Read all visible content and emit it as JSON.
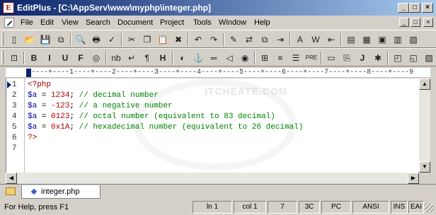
{
  "title": "EditPlus - [C:\\AppServ\\www\\myphp\\integer.php]",
  "window_buttons": {
    "minimize": "_",
    "restore": "□",
    "close": "×"
  },
  "menu": [
    "File",
    "Edit",
    "View",
    "Search",
    "Document",
    "Project",
    "Tools",
    "Window",
    "Help"
  ],
  "toolbar1": [
    {
      "name": "new-file-icon",
      "glyph": "▯"
    },
    {
      "name": "open-icon",
      "glyph": "📂"
    },
    {
      "name": "save-icon",
      "glyph": "💾"
    },
    {
      "name": "save-all-icon",
      "glyph": "⧉"
    },
    {
      "name": "find-icon",
      "glyph": "🔍"
    },
    {
      "name": "print-icon",
      "glyph": "🖶"
    },
    {
      "name": "spell-check-icon",
      "glyph": "✓"
    },
    {
      "name": "cut-icon",
      "glyph": "✂"
    },
    {
      "name": "copy-icon",
      "glyph": "❐"
    },
    {
      "name": "paste-icon",
      "glyph": "📋"
    },
    {
      "name": "delete-icon",
      "glyph": "✖"
    },
    {
      "name": "undo-icon",
      "glyph": "↶"
    },
    {
      "name": "redo-icon",
      "glyph": "↷"
    },
    {
      "name": "highlight-icon",
      "glyph": "✎"
    },
    {
      "name": "replace-icon",
      "glyph": "⇄"
    },
    {
      "name": "copy-format-icon",
      "glyph": "⧉"
    },
    {
      "name": "goto-icon",
      "glyph": "⇥"
    },
    {
      "name": "font-icon",
      "glyph": "A"
    },
    {
      "name": "word-wrap-icon",
      "glyph": "W"
    },
    {
      "name": "insert-char-icon",
      "glyph": "⇤"
    },
    {
      "name": "ruler-toggle-icon",
      "glyph": "▤"
    },
    {
      "name": "line-number-icon",
      "glyph": "▦"
    },
    {
      "name": "output-window-icon",
      "glyph": "▣"
    },
    {
      "name": "cliptext-icon",
      "glyph": "▥"
    },
    {
      "name": "directory-icon",
      "glyph": "▧"
    }
  ],
  "toolbar2": [
    {
      "name": "html-toolbar-icon",
      "glyph": "⊡"
    },
    {
      "name": "bold-button",
      "glyph": "B",
      "bold": true
    },
    {
      "name": "italic-button",
      "glyph": "I",
      "bold": true
    },
    {
      "name": "underline-button",
      "glyph": "U",
      "bold": true
    },
    {
      "name": "font-tag-button",
      "glyph": "F",
      "bold": true
    },
    {
      "name": "color-icon",
      "glyph": "◎"
    },
    {
      "name": "nbsp-button",
      "glyph": "nb"
    },
    {
      "name": "line-break-button",
      "glyph": "↵"
    },
    {
      "name": "paragraph-button",
      "glyph": "¶"
    },
    {
      "name": "heading-button",
      "glyph": "H",
      "bold": true
    },
    {
      "name": "image-icon",
      "glyph": "◐"
    },
    {
      "name": "anchor-icon",
      "glyph": "⚓"
    },
    {
      "name": "horizontal-rule-icon",
      "glyph": "═"
    },
    {
      "name": "comment-icon",
      "glyph": "◁"
    },
    {
      "name": "target-icon",
      "glyph": "◉"
    },
    {
      "name": "table-icon",
      "glyph": "⊞"
    },
    {
      "name": "center-icon",
      "glyph": "≡"
    },
    {
      "name": "align-icon",
      "glyph": "☰"
    },
    {
      "name": "pre-button",
      "glyph": "PRE"
    },
    {
      "name": "form-icon",
      "glyph": "▭"
    },
    {
      "name": "html-template-icon",
      "glyph": "⎘"
    },
    {
      "name": "javascript-button",
      "glyph": "J",
      "bold": true
    },
    {
      "name": "style-icon",
      "glyph": "✱"
    },
    {
      "name": "preview-icon",
      "glyph": "◰"
    },
    {
      "name": "browser-icon",
      "glyph": "◱"
    },
    {
      "name": "toolbar-extra-icon",
      "glyph": "▨"
    }
  ],
  "ruler": "----+----1----+----2----+----3----+----4----+----5----+----6----+----7----+----8----+----9",
  "code_lines": [
    {
      "num": "1",
      "parts": [
        {
          "t": "<?php",
          "c": "c-php"
        }
      ]
    },
    {
      "num": "2",
      "parts": [
        {
          "t": "$a",
          "c": "c-var"
        },
        {
          "t": " = ",
          "c": "c-op"
        },
        {
          "t": "1234",
          "c": "c-num"
        },
        {
          "t": "; ",
          "c": "c-op"
        },
        {
          "t": "// decimal number",
          "c": "c-cm"
        }
      ]
    },
    {
      "num": "3",
      "parts": [
        {
          "t": "$a",
          "c": "c-var"
        },
        {
          "t": " = ",
          "c": "c-op"
        },
        {
          "t": "-123",
          "c": "c-num"
        },
        {
          "t": "; ",
          "c": "c-op"
        },
        {
          "t": "// a negative number",
          "c": "c-cm"
        }
      ]
    },
    {
      "num": "4",
      "parts": [
        {
          "t": "$a",
          "c": "c-var"
        },
        {
          "t": " = ",
          "c": "c-op"
        },
        {
          "t": "0123",
          "c": "c-num"
        },
        {
          "t": "; ",
          "c": "c-op"
        },
        {
          "t": "// octal number (equivalent to 83 decimal)",
          "c": "c-cm"
        }
      ]
    },
    {
      "num": "5",
      "parts": [
        {
          "t": "$a",
          "c": "c-var"
        },
        {
          "t": " = ",
          "c": "c-op"
        },
        {
          "t": "0x1A",
          "c": "c-num"
        },
        {
          "t": "; ",
          "c": "c-op"
        },
        {
          "t": "// hexadecimal number (equivalent to 26 decimal)",
          "c": "c-cm"
        }
      ]
    },
    {
      "num": "6",
      "parts": [
        {
          "t": "?>",
          "c": "c-php"
        }
      ]
    },
    {
      "num": "7",
      "parts": []
    }
  ],
  "watermark": "ITCHEATE.COM",
  "tab_label": "integer.php",
  "status": {
    "help": "For Help, press F1",
    "line": "ln 1",
    "col": "col 1",
    "count": "7",
    "code": "3C",
    "mode": "PC",
    "encoding": "ANSI",
    "ins": "INS",
    "extra": "EAI"
  }
}
